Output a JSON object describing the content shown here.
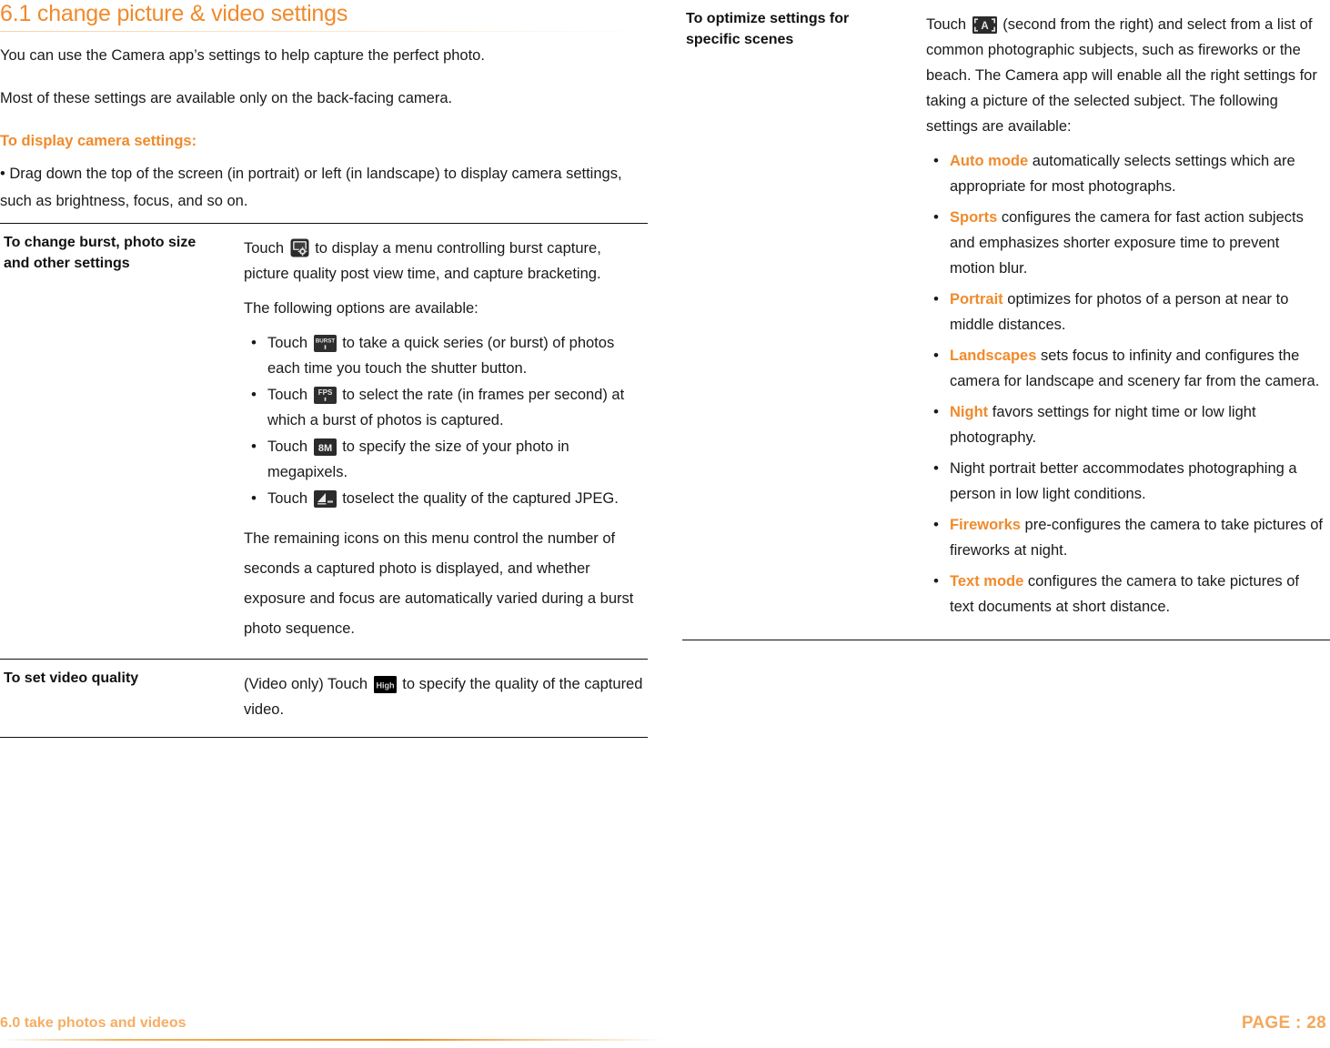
{
  "section": {
    "number": "6.1",
    "heading": "6.1 change picture & video settings",
    "intro_1": "You can use the Camera app’s settings to help capture the perfect photo.",
    "intro_2": "Most of these settings are available only on the back-facing camera.",
    "subhead": "To display camera settings:",
    "bullet_1": "• Drag down the top of the screen (in portrait) or left (in landscape) to display camera settings, such as brightness, focus, and so on."
  },
  "left_table": {
    "rows": [
      {
        "label": "To change burst, photo size and other settings",
        "para_1_before_icon": "Touch",
        "icon_1": "camera-settings-icon",
        "para_1_after_icon": "to display a menu controlling burst capture, picture quality post view time, and capture bracketing.",
        "para_2": "The following options are available:",
        "options": [
          {
            "before": "Touch",
            "icon": "burst-icon",
            "after": "to take a quick series (or burst) of photos each time you touch the shutter button."
          },
          {
            "before": "Touch",
            "icon": "fps-icon",
            "after": "to select the rate (in frames per second) at which a burst of photos is captured."
          },
          {
            "before": "Touch",
            "icon": "megapixel-8m-icon",
            "after": "to specify the size of your photo in megapixels."
          },
          {
            "before": "Touch",
            "icon": "jpeg-quality-icon",
            "after": "toselect the quality of the captured JPEG."
          }
        ],
        "para_3": "The remaining icons on this menu control the number of seconds a captured photo is displayed, and whether exposure and focus are automatically varied during a burst photo sequence."
      },
      {
        "label": "To set video quality",
        "before_icon": "(Video only) Touch",
        "icon": "video-quality-high-icon",
        "after_icon": "to specify the quality of the captured video."
      }
    ]
  },
  "right_table": {
    "label": "To optimize settings for specific scenes",
    "intro_before_icon": "Touch",
    "intro_icon": "scene-auto-icon",
    "intro_after_icon": "(second from the right) and select from a list of common photographic subjects, such as fireworks or the beach. The Camera app will enable all the right settings for taking a picture of the selected subject. The following settings are available:",
    "scene_modes": [
      {
        "term": "Auto mode",
        "text": "automatically selects settings which are appropriate for most photographs."
      },
      {
        "term": "Sports",
        "text": "configures the camera for fast action subjects and emphasizes shorter exposure time to prevent motion blur."
      },
      {
        "term": "Portrait",
        "text": "optimizes for photos of a person at near to middle distances."
      },
      {
        "term": "Landscapes",
        "text": "sets focus to infinity and configures the camera for landscape and scenery far from the camera."
      },
      {
        "term": "Night",
        "text": "favors settings for night time or low light photography."
      },
      {
        "term": "",
        "text": "Night portrait better accommodates photographing a person in low light conditions."
      },
      {
        "term": "Fireworks",
        "text": "pre-configures the camera to take pictures of fireworks at night."
      },
      {
        "term": "Text mode",
        "text": "configures the camera to take pictures of text documents at short distance."
      }
    ]
  },
  "footer": {
    "chapter": "6.0 take photos and videos",
    "page": "PAGE : 28"
  },
  "colors": {
    "accent_orange": "#F08A2B",
    "footer_orange": "#F4A85C",
    "body_text": "#1a1a1a"
  }
}
